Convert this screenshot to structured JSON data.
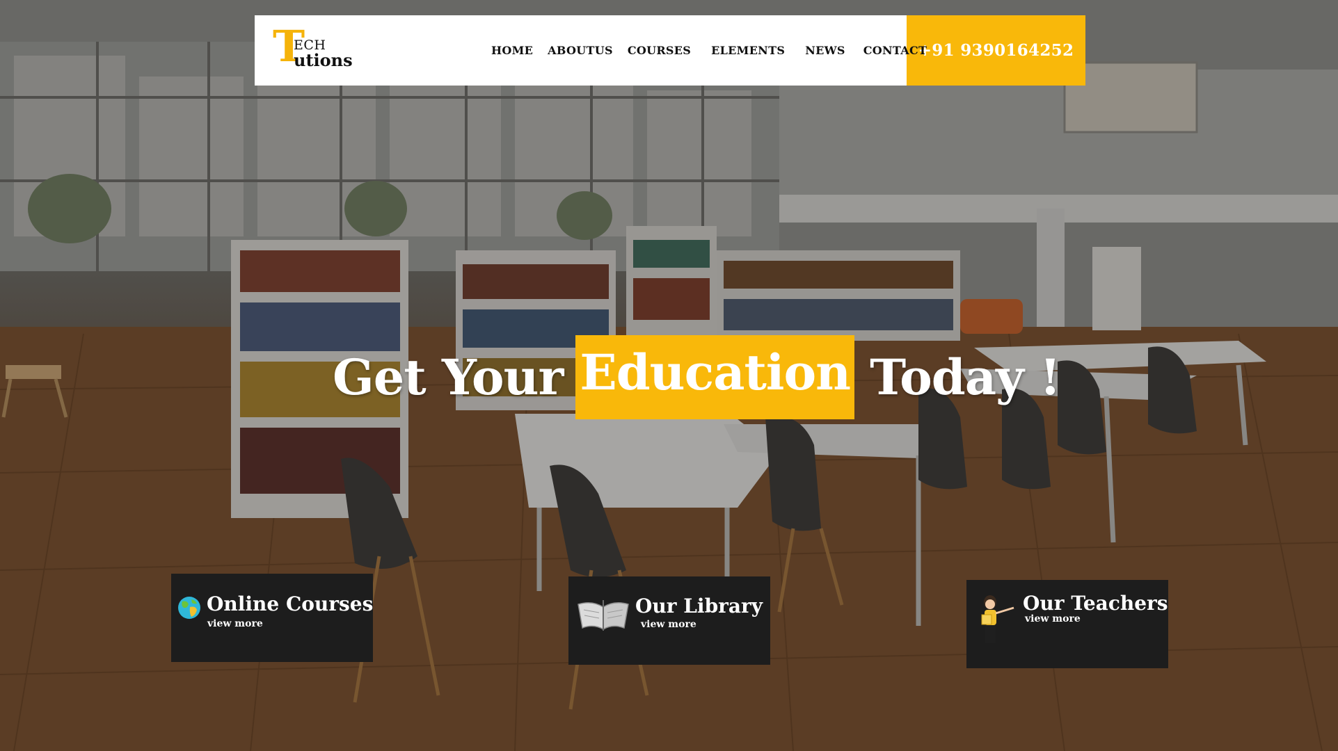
{
  "brand": {
    "logo_big_letter": "T",
    "logo_top": "ECH",
    "logo_bottom": "utions",
    "accent_color": "#f9b80a"
  },
  "nav": {
    "items": [
      {
        "label": "HOME"
      },
      {
        "label": "ABOUTUS"
      },
      {
        "label": "COURSES"
      },
      {
        "label": "ELEMENTS"
      },
      {
        "label": "NEWS"
      },
      {
        "label": "CONTACT"
      }
    ],
    "phone": "+91 9390164252"
  },
  "hero": {
    "headline_before": "Get Your",
    "headline_highlight": "Education",
    "headline_after": "Today !"
  },
  "features": [
    {
      "title": "Online Courses",
      "more": "view more",
      "icon": "globe-icon"
    },
    {
      "title": "Our Library",
      "more": "view more",
      "icon": "open-book-icon"
    },
    {
      "title": "Our Teachers",
      "more": "view more",
      "icon": "teacher-icon"
    }
  ]
}
